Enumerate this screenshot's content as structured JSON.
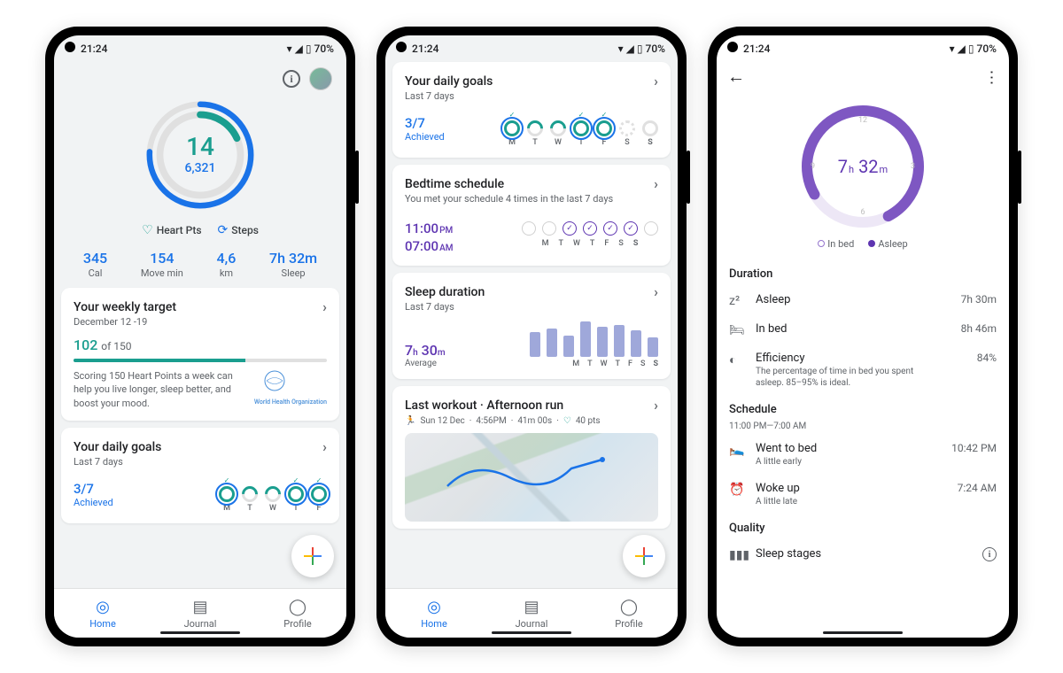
{
  "status": {
    "time": "21:24",
    "battery": "70%"
  },
  "phone1": {
    "heart_points": "14",
    "steps": "6,321",
    "legend": {
      "heart": "Heart Pts",
      "steps": "Steps"
    },
    "metrics": [
      {
        "val": "345",
        "lbl": "Cal"
      },
      {
        "val": "154",
        "lbl": "Move min"
      },
      {
        "val": "4,6",
        "lbl": "km"
      },
      {
        "val": "7h 32m",
        "lbl": "Sleep"
      }
    ],
    "weekly": {
      "title": "Your weekly target",
      "date_range": "December 12 -19",
      "value": "102",
      "of": "of 150",
      "text": "Scoring 150 Heart Points a week can help you live longer, sleep better, and boost your mood.",
      "who": "World Health Organization"
    },
    "daily": {
      "title": "Your daily goals",
      "sub": "Last 7 days",
      "achieved": "3/7",
      "achieved_lbl": "Achieved",
      "days": [
        "M",
        "T",
        "W",
        "T",
        "F"
      ]
    }
  },
  "phone2": {
    "daily": {
      "title": "Your daily goals",
      "sub": "Last 7 days",
      "achieved": "3/7",
      "achieved_lbl": "Achieved",
      "days": [
        "M",
        "T",
        "W",
        "T",
        "F",
        "S",
        "S"
      ]
    },
    "bedtime": {
      "title": "Bedtime schedule",
      "sub": "You met your schedule 4 times in the last 7 days",
      "time_sleep": "11:00",
      "time_sleep_ampm": "PM",
      "time_wake": "07:00",
      "time_wake_ampm": "AM",
      "days": [
        "M",
        "T",
        "W",
        "T",
        "F",
        "S",
        "S"
      ]
    },
    "sleep": {
      "title": "Sleep duration",
      "sub": "Last 7 days",
      "avg_h": "7",
      "avg_m": "30",
      "avg_lbl": "Average",
      "bars": [
        28,
        32,
        24,
        40,
        34,
        36,
        30,
        22
      ],
      "days": [
        "M",
        "T",
        "W",
        "T",
        "F",
        "S",
        "S"
      ]
    },
    "workout": {
      "title": "Last workout · Afternoon run",
      "meta_date": "Sun 12 Dec",
      "meta_time": "4:56PM",
      "meta_dur": "41m 00s",
      "meta_pts": "40 pts"
    }
  },
  "phone3": {
    "time_h": "7",
    "time_m": "32",
    "legend_inbed": "In bed",
    "legend_asleep": "Asleep",
    "duration": {
      "h": "Duration",
      "asleep": {
        "t": "Asleep",
        "v": "7h 30m"
      },
      "inbed": {
        "t": "In bed",
        "v": "8h 46m"
      },
      "eff": {
        "t": "Efficiency",
        "v": "84%",
        "sub": "The percentage of time in bed you spent asleep. 85–95% is ideal."
      }
    },
    "schedule": {
      "h": "Schedule",
      "range": "11:00 PM—7:00 AM",
      "bed": {
        "t": "Went to bed",
        "sub": "A little early",
        "v": "10:42 PM"
      },
      "woke": {
        "t": "Woke up",
        "sub": "A little late",
        "v": "7:24 AM"
      }
    },
    "quality": {
      "h": "Quality",
      "stages": "Sleep stages"
    }
  },
  "nav": {
    "home": "Home",
    "journal": "Journal",
    "profile": "Profile"
  }
}
